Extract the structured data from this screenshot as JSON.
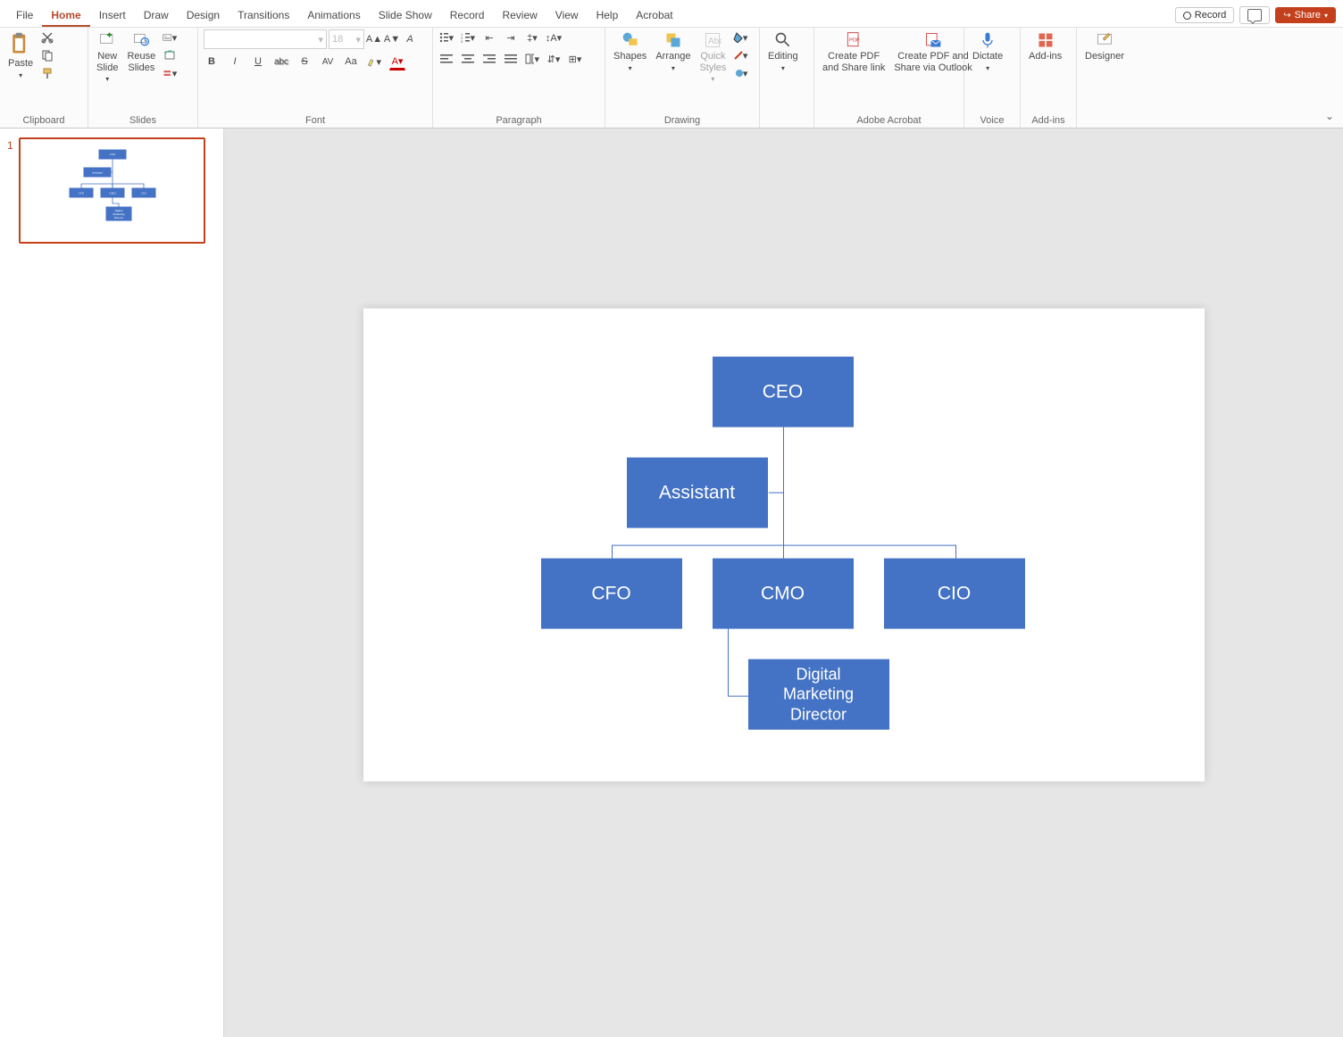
{
  "menu": {
    "tabs": [
      "File",
      "Home",
      "Insert",
      "Draw",
      "Design",
      "Transitions",
      "Animations",
      "Slide Show",
      "Record",
      "Review",
      "View",
      "Help",
      "Acrobat"
    ],
    "active": "Home",
    "record": "Record",
    "share": "Share"
  },
  "ribbon": {
    "clipboard": {
      "paste": "Paste",
      "group": "Clipboard"
    },
    "slides": {
      "new": "New\nSlide",
      "reuse": "Reuse\nSlides",
      "group": "Slides"
    },
    "font": {
      "placeholder": "",
      "size": "18",
      "group": "Font",
      "bold": "B",
      "italic": "I",
      "underline": "U",
      "strike": "S",
      "shadow": "abc",
      "spacing": "AV",
      "case": "Aa",
      "clear": "A"
    },
    "paragraph": {
      "group": "Paragraph"
    },
    "drawing": {
      "shapes": "Shapes",
      "arrange": "Arrange",
      "quick": "Quick\nStyles",
      "group": "Drawing"
    },
    "editing": {
      "label": "Editing"
    },
    "adobe": {
      "pdf1": "Create PDF\nand Share link",
      "pdf2": "Create PDF and\nShare via Outlook",
      "group": "Adobe Acrobat"
    },
    "voice": {
      "dictate": "Dictate",
      "group": "Voice"
    },
    "addins": {
      "label": "Add-ins",
      "group": "Add-ins"
    },
    "designer": {
      "label": "Designer"
    }
  },
  "thumb": {
    "num": "1"
  },
  "org": {
    "ceo": "CEO",
    "assistant": "Assistant",
    "cfo": "CFO",
    "cmo": "CMO",
    "cio": "CIO",
    "dmd": "Digital\nMarketing\nDirector"
  },
  "chart_data": {
    "type": "table",
    "title": "Organization Chart",
    "nodes": [
      {
        "id": "ceo",
        "label": "CEO",
        "parent": null
      },
      {
        "id": "assistant",
        "label": "Assistant",
        "parent": "ceo",
        "relation": "assistant"
      },
      {
        "id": "cfo",
        "label": "CFO",
        "parent": "ceo"
      },
      {
        "id": "cmo",
        "label": "CMO",
        "parent": "ceo"
      },
      {
        "id": "cio",
        "label": "CIO",
        "parent": "ceo"
      },
      {
        "id": "dmd",
        "label": "Digital Marketing Director",
        "parent": "cmo"
      }
    ]
  }
}
